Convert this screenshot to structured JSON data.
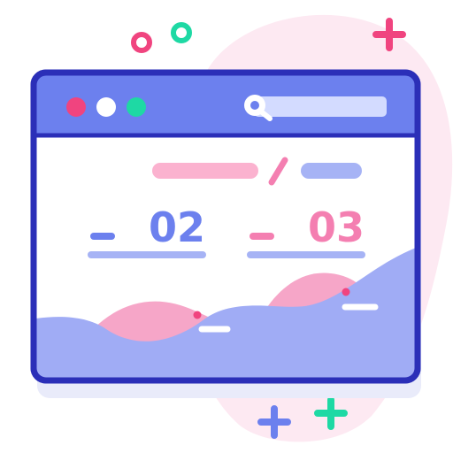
{
  "slide": {
    "left_number": "02",
    "right_number": "03"
  },
  "colors": {
    "outline": "#2b2fb8",
    "titlebar": "#6c80ee",
    "search_bar": "#d3dbff",
    "pink": "#f47fb1",
    "pink_light": "#fbb2cf",
    "blue": "#6c80ee",
    "blue_light": "#a6b3f5",
    "wave_blue": "#a0acf5",
    "wave_pink": "#f6a6c8",
    "dot_red": "#f0447f",
    "dot_white": "#ffffff",
    "dot_green": "#1ed9a4",
    "blob": "#fde9f2",
    "content_bg": "#ffffff"
  },
  "icons": {
    "window_controls": [
      "close-dot",
      "minimize-dot",
      "maximize-dot"
    ],
    "search": "magnifier-icon",
    "decor": [
      "ring-pink-icon",
      "ring-green-icon",
      "sparkle-pink-icon",
      "sparkle-blue-icon",
      "sparkle-green-icon"
    ]
  }
}
